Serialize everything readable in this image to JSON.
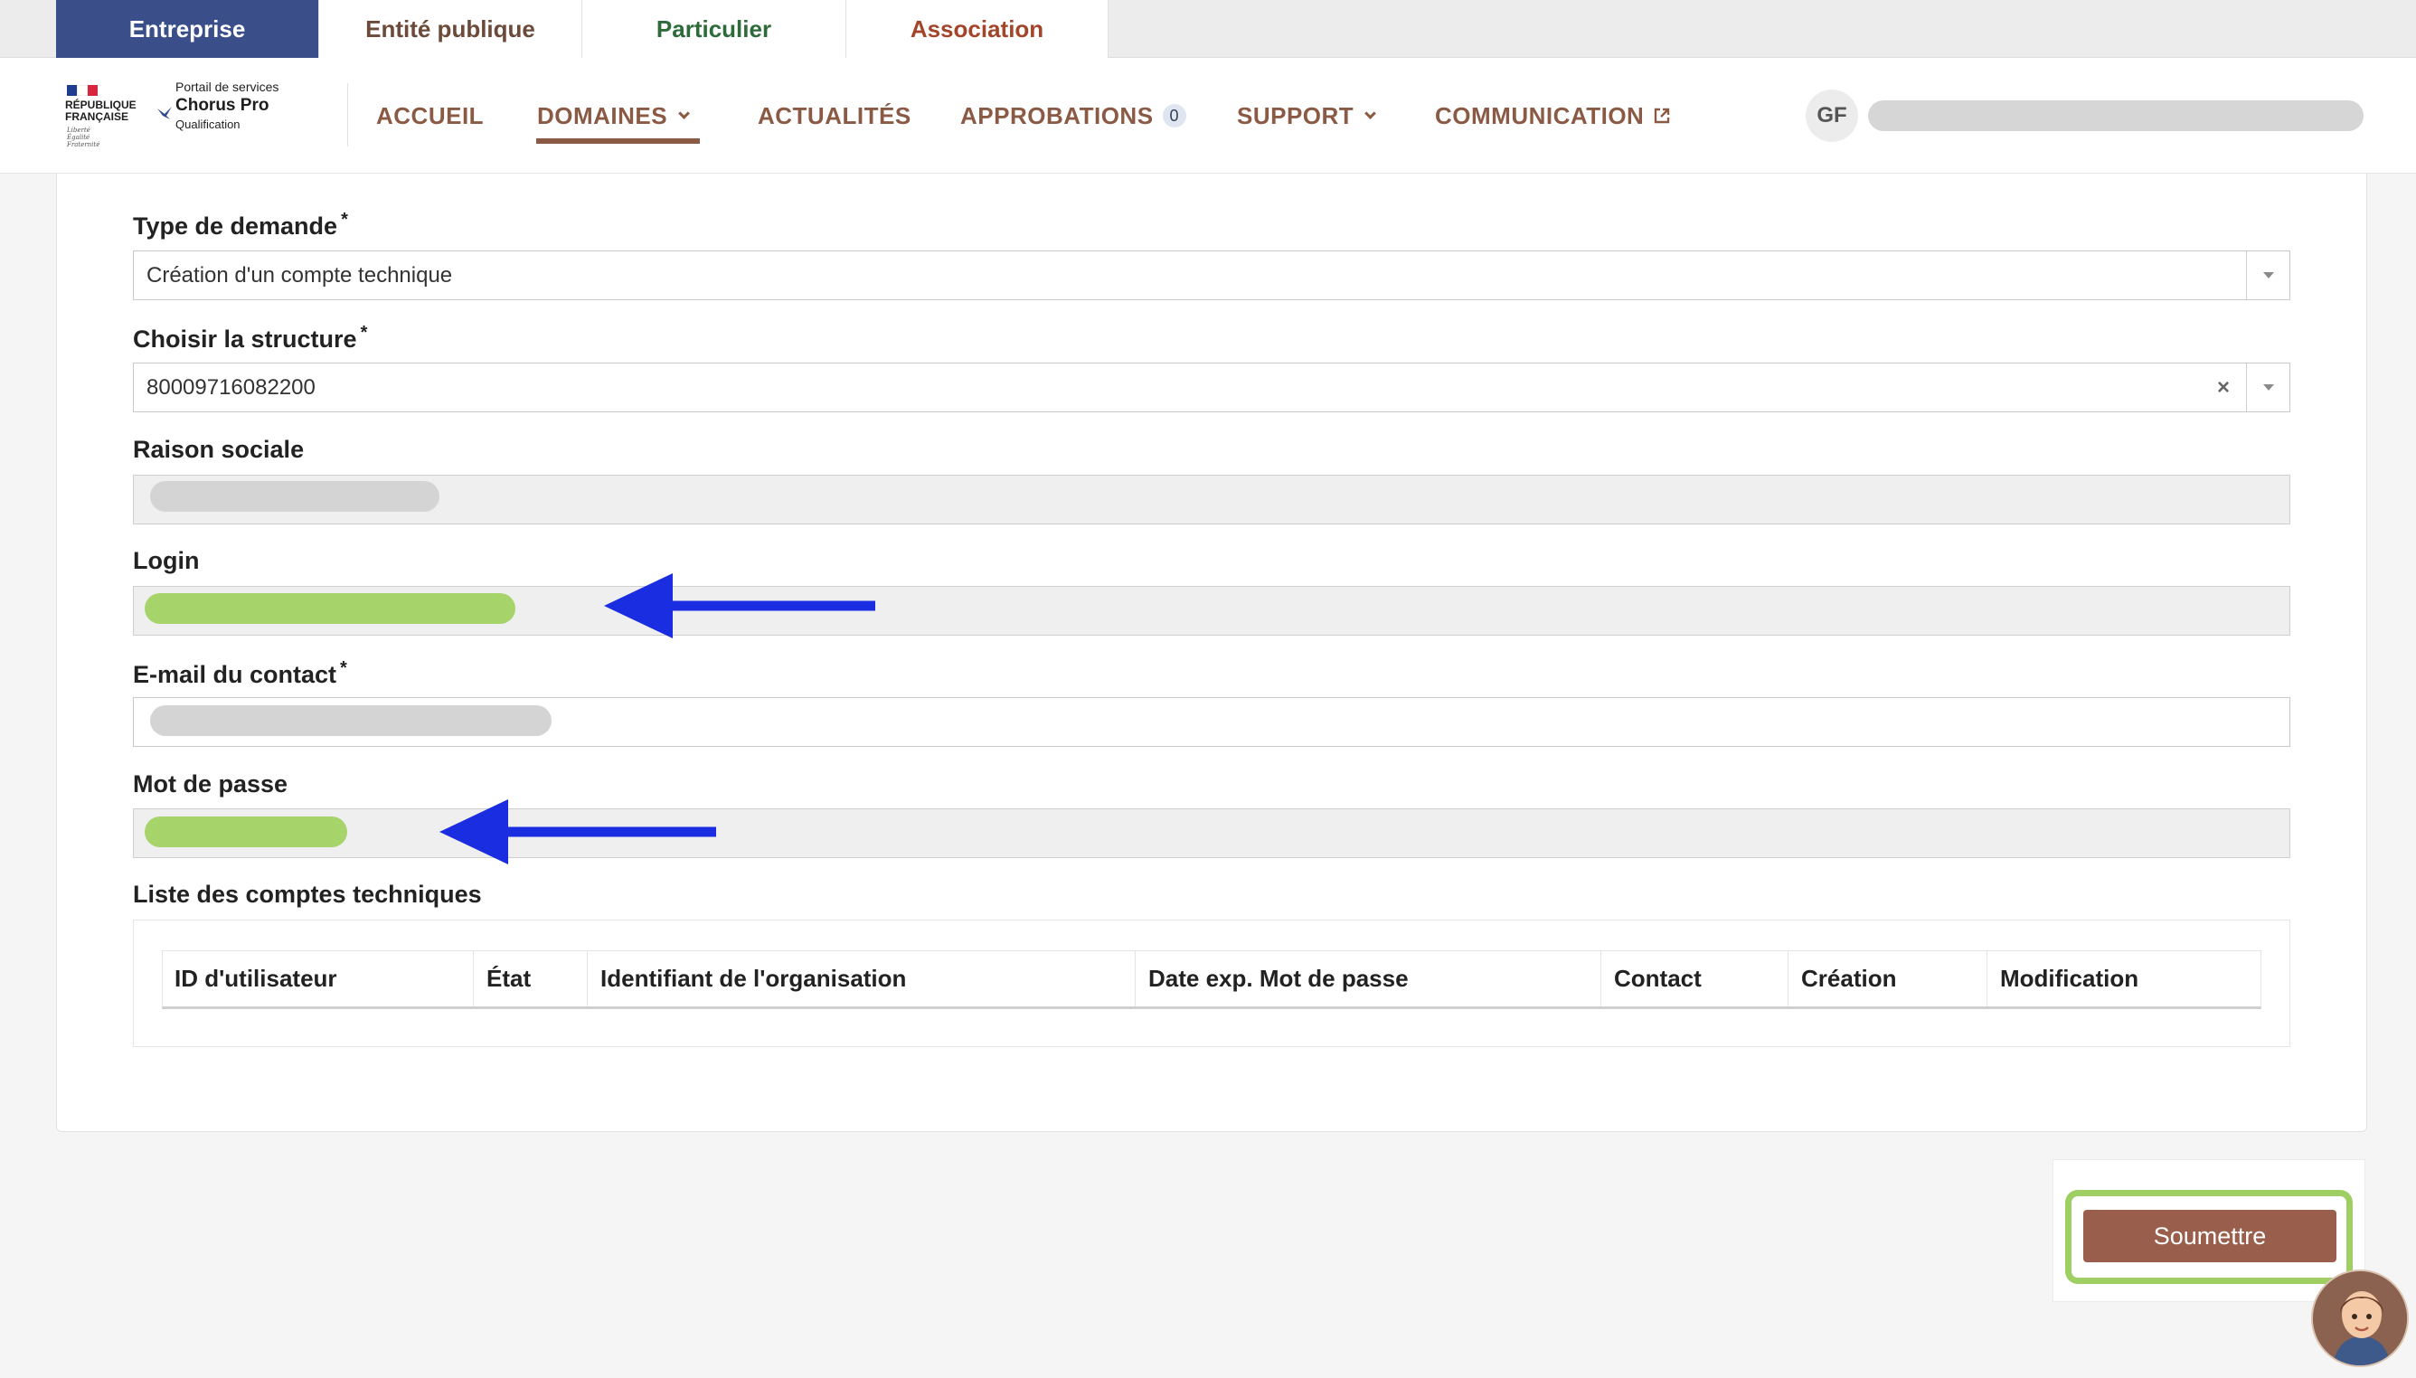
{
  "audience_tabs": [
    "Entreprise",
    "Entité publique",
    "Particulier",
    "Association"
  ],
  "audience_colors": [
    "#ffffff",
    "#6b4a3a",
    "#2e6b3a",
    "#a3452b"
  ],
  "logo": {
    "republic": "RÉPUBLIQUE FRANÇAISE",
    "motto": "Liberté Égalité Fraternité",
    "portal_line1": "Portail de services",
    "portal_name": "Chorus Pro",
    "environment": "Qualification"
  },
  "nav": {
    "home": "ACCUEIL",
    "domains": "DOMAINES",
    "news": "ACTUALITÉS",
    "approvals": "APPROBATIONS",
    "approvals_count": "0",
    "support": "SUPPORT",
    "communication": "COMMUNICATION"
  },
  "user": {
    "initials": "GF"
  },
  "form": {
    "request_type_label": "Type de demande",
    "request_type_value": "Création d'un compte technique",
    "structure_label": "Choisir la structure",
    "structure_value": "80009716082200",
    "clear_symbol": "×",
    "company_name_label": "Raison sociale",
    "login_label": "Login",
    "email_label": "E-mail du contact",
    "password_label": "Mot de passe",
    "required_marker": "*",
    "tech_accounts_label": "Liste des comptes techniques"
  },
  "table": {
    "columns": [
      "ID d'utilisateur",
      "État",
      "Identifiant de l'organisation",
      "Date exp. Mot de passe",
      "Contact",
      "Création",
      "Modification"
    ]
  },
  "submit_label": "Soumettre",
  "colors": {
    "accent_brown": "#8a5a45",
    "active_tab": "#3a4f8a",
    "highlight_green": "#9fce63",
    "annotation_arrow": "#1a2de0"
  }
}
